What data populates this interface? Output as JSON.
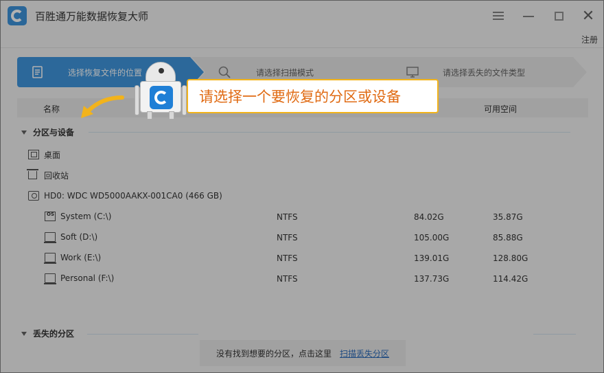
{
  "app": {
    "title": "百胜通万能数据恢复大师",
    "register": "注册"
  },
  "steps": [
    {
      "label": "选择恢复文件的位置",
      "active": true,
      "icon": "document-icon"
    },
    {
      "label": "请选择扫描模式",
      "active": false,
      "icon": "search-icon"
    },
    {
      "label": "请选择丢失的文件类型",
      "active": false,
      "icon": "monitor-icon"
    }
  ],
  "columns": {
    "name": "名称",
    "free": "可用空间"
  },
  "sections": {
    "partitions": "分区与设备",
    "lost": "丢失的分区"
  },
  "locations": [
    {
      "label": "桌面",
      "icon": "desktop-icon"
    },
    {
      "label": "回收站",
      "icon": "recycle-bin-icon"
    }
  ],
  "disk": {
    "label": "HD0: WDC WD5000AAKX-001CA0 (466 GB)",
    "icon": "hard-disk-icon"
  },
  "partitions": [
    {
      "name": "System (C:\\)",
      "fs": "NTFS",
      "total": "84.02G",
      "free": "35.87G",
      "icon": "system-drive-icon"
    },
    {
      "name": "Soft (D:\\)",
      "fs": "NTFS",
      "total": "105.00G",
      "free": "85.88G",
      "icon": "drive-icon"
    },
    {
      "name": "Work (E:\\)",
      "fs": "NTFS",
      "total": "139.01G",
      "free": "128.80G",
      "icon": "drive-icon"
    },
    {
      "name": "Personal (F:\\)",
      "fs": "NTFS",
      "total": "137.73G",
      "free": "114.42G",
      "icon": "drive-icon"
    }
  ],
  "bottom": {
    "text": "没有找到想要的分区，点击这里",
    "link": "扫描丢失分区"
  },
  "tooltip": {
    "text": "请选择一个要恢复的分区或设备"
  },
  "colors": {
    "accent": "#2f8ddb",
    "callout_text": "#e06a12",
    "callout_border": "#f2b31b",
    "link": "#1a5fb4"
  }
}
